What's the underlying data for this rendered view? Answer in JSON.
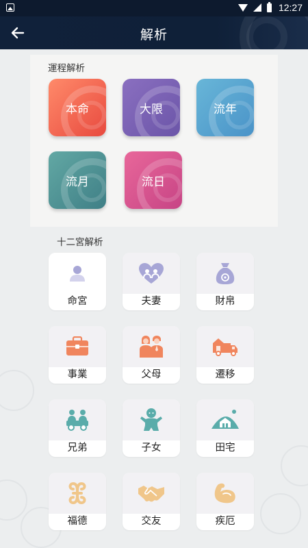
{
  "status_bar": {
    "time": "12:27"
  },
  "app_bar": {
    "title": "解析",
    "back_icon": "arrow-left-icon"
  },
  "fortune": {
    "title": "運程解析",
    "items": [
      {
        "label": "本命",
        "color_from": "#ff8a6a",
        "color_to": "#e84a3f"
      },
      {
        "label": "大限",
        "color_from": "#8a6fc0",
        "color_to": "#6b55a8"
      },
      {
        "label": "流年",
        "color_from": "#68b6d8",
        "color_to": "#4a93c8"
      },
      {
        "label": "流月",
        "color_from": "#62a8a4",
        "color_to": "#3f7f86"
      },
      {
        "label": "流日",
        "color_from": "#e8679a",
        "color_to": "#c74485"
      }
    ]
  },
  "palaces": {
    "title": "十二宮解析",
    "items": [
      {
        "label": "命宮",
        "icon": "person-icon",
        "color": "#a7a6d6"
      },
      {
        "label": "夫妻",
        "icon": "couple-heart-icon",
        "color": "#a7a6d6"
      },
      {
        "label": "財帛",
        "icon": "money-bag-icon",
        "color": "#a7a6d6"
      },
      {
        "label": "事業",
        "icon": "briefcase-icon",
        "color": "#f0855d"
      },
      {
        "label": "父母",
        "icon": "parents-icon",
        "color": "#f0855d"
      },
      {
        "label": "遷移",
        "icon": "moving-truck-icon",
        "color": "#f0855d"
      },
      {
        "label": "兄弟",
        "icon": "siblings-icon",
        "color": "#5aacaa"
      },
      {
        "label": "子女",
        "icon": "child-icon",
        "color": "#5aacaa"
      },
      {
        "label": "田宅",
        "icon": "house-land-icon",
        "color": "#5aacaa"
      },
      {
        "label": "福德",
        "icon": "knot-icon",
        "color": "#f0c68a"
      },
      {
        "label": "交友",
        "icon": "handshake-icon",
        "color": "#f0c68a"
      },
      {
        "label": "疾厄",
        "icon": "muscle-arm-icon",
        "color": "#f0c68a"
      }
    ]
  }
}
